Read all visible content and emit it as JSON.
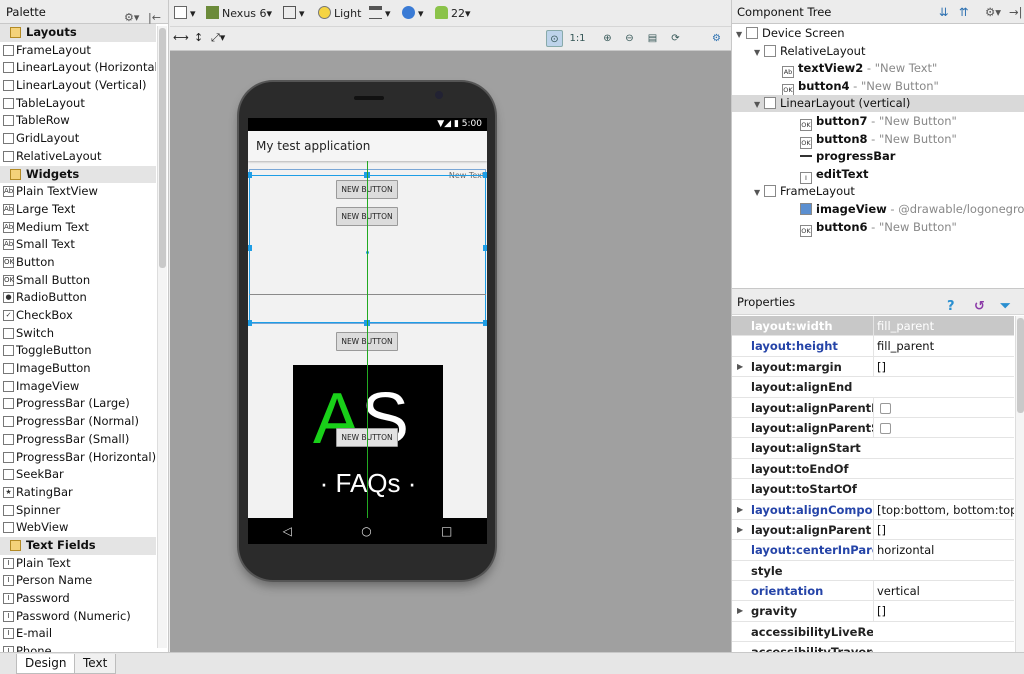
{
  "palette": {
    "title": "Palette",
    "items": [
      {
        "label": "Layouts",
        "cat": true
      },
      {
        "label": "FrameLayout",
        "icon": ""
      },
      {
        "label": "LinearLayout (Horizontal)",
        "icon": ""
      },
      {
        "label": "LinearLayout (Vertical)",
        "icon": ""
      },
      {
        "label": "TableLayout",
        "icon": ""
      },
      {
        "label": "TableRow",
        "icon": ""
      },
      {
        "label": "GridLayout",
        "icon": ""
      },
      {
        "label": "RelativeLayout",
        "icon": ""
      },
      {
        "label": "Widgets",
        "cat": true
      },
      {
        "label": "Plain TextView",
        "icon": "Ab"
      },
      {
        "label": "Large Text",
        "icon": "Ab"
      },
      {
        "label": "Medium Text",
        "icon": "Ab"
      },
      {
        "label": "Small Text",
        "icon": "Ab"
      },
      {
        "label": "Button",
        "icon": "OK"
      },
      {
        "label": "Small Button",
        "icon": "OK"
      },
      {
        "label": "RadioButton",
        "icon": "●"
      },
      {
        "label": "CheckBox",
        "icon": "✓"
      },
      {
        "label": "Switch",
        "icon": ""
      },
      {
        "label": "ToggleButton",
        "icon": ""
      },
      {
        "label": "ImageButton",
        "icon": ""
      },
      {
        "label": "ImageView",
        "icon": ""
      },
      {
        "label": "ProgressBar (Large)",
        "icon": ""
      },
      {
        "label": "ProgressBar (Normal)",
        "icon": ""
      },
      {
        "label": "ProgressBar (Small)",
        "icon": ""
      },
      {
        "label": "ProgressBar (Horizontal)",
        "icon": ""
      },
      {
        "label": "SeekBar",
        "icon": ""
      },
      {
        "label": "RatingBar",
        "icon": "★"
      },
      {
        "label": "Spinner",
        "icon": ""
      },
      {
        "label": "WebView",
        "icon": ""
      },
      {
        "label": "Text Fields",
        "cat": true
      },
      {
        "label": "Plain Text",
        "icon": "I"
      },
      {
        "label": "Person Name",
        "icon": "I"
      },
      {
        "label": "Password",
        "icon": "I"
      },
      {
        "label": "Password (Numeric)",
        "icon": "I"
      },
      {
        "label": "E-mail",
        "icon": "I"
      },
      {
        "label": "Phone",
        "icon": "I"
      }
    ]
  },
  "toolbar": {
    "device": "Nexus 6",
    "theme": "Light",
    "api": "22"
  },
  "phone": {
    "time": "5:00",
    "app_title": "My test application",
    "new_text": "New Text",
    "buttons": [
      "NEW BUTTON",
      "NEW BUTTON",
      "NEW BUTTON",
      "NEW BUTTON"
    ],
    "logo_big": "AS",
    "logo_small": "· FAQs ·",
    "nav": [
      "◁",
      "○",
      "□"
    ]
  },
  "tree": {
    "title": "Component Tree",
    "rows": [
      {
        "name": "Device Screen",
        "hint": "",
        "bold": false,
        "icon": "device"
      },
      {
        "name": "RelativeLayout",
        "hint": "",
        "bold": false,
        "icon": "rel"
      },
      {
        "name": "textView2",
        "hint": " - \"New Text\"",
        "bold": true,
        "icon": "Ab"
      },
      {
        "name": "button4",
        "hint": " - \"New Button\"",
        "bold": true,
        "icon": "OK"
      },
      {
        "name": "LinearLayout (vertical)",
        "hint": "",
        "bold": false,
        "icon": "lin"
      },
      {
        "name": "button7",
        "hint": " - \"New Button\"",
        "bold": true,
        "icon": "OK"
      },
      {
        "name": "button8",
        "hint": " - \"New Button\"",
        "bold": true,
        "icon": "OK"
      },
      {
        "name": "progressBar",
        "hint": "",
        "bold": true,
        "icon": "prog"
      },
      {
        "name": "editText",
        "hint": "",
        "bold": true,
        "icon": "I"
      },
      {
        "name": "FrameLayout",
        "hint": "",
        "bold": false,
        "icon": "frame"
      },
      {
        "name": "imageView",
        "hint": " - @drawable/logonegro",
        "bold": true,
        "icon": "img"
      },
      {
        "name": "button6",
        "hint": " - \"New Button\"",
        "bold": true,
        "icon": "OK"
      }
    ]
  },
  "properties": {
    "title": "Properties",
    "rows": [
      {
        "name": "layout:width",
        "value": "fill_parent",
        "blue": false,
        "expand": false,
        "sel": true
      },
      {
        "name": "layout:height",
        "value": "fill_parent",
        "blue": true,
        "expand": false
      },
      {
        "name": "layout:margin",
        "value": "[]",
        "blue": false,
        "expand": true
      },
      {
        "name": "layout:alignEnd",
        "value": "",
        "blue": false,
        "expand": false
      },
      {
        "name": "layout:alignParentEnd",
        "value": "",
        "check": true,
        "blue": false,
        "expand": false
      },
      {
        "name": "layout:alignParentStart",
        "value": "",
        "check": true,
        "blue": false,
        "expand": false
      },
      {
        "name": "layout:alignStart",
        "value": "",
        "blue": false,
        "expand": false
      },
      {
        "name": "layout:toEndOf",
        "value": "",
        "blue": false,
        "expand": false
      },
      {
        "name": "layout:toStartOf",
        "value": "",
        "blue": false,
        "expand": false
      },
      {
        "name": "layout:alignComponent",
        "value": "[top:bottom, bottom:top]",
        "blue": true,
        "expand": true
      },
      {
        "name": "layout:alignParent",
        "value": "[]",
        "blue": false,
        "expand": true
      },
      {
        "name": "layout:centerInParent",
        "value": "horizontal",
        "blue": true,
        "expand": false
      },
      {
        "name": "style",
        "value": "",
        "blue": false,
        "expand": false
      },
      {
        "name": "orientation",
        "value": "vertical",
        "blue": true,
        "expand": false
      },
      {
        "name": "gravity",
        "value": "[]",
        "blue": false,
        "expand": true
      },
      {
        "name": "accessibilityLiveRegion",
        "value": "",
        "blue": false,
        "expand": false
      },
      {
        "name": "accessibilityTraversal",
        "value": "",
        "blue": false,
        "expand": false
      }
    ]
  },
  "bottom_tabs": [
    "Design",
    "Text"
  ]
}
